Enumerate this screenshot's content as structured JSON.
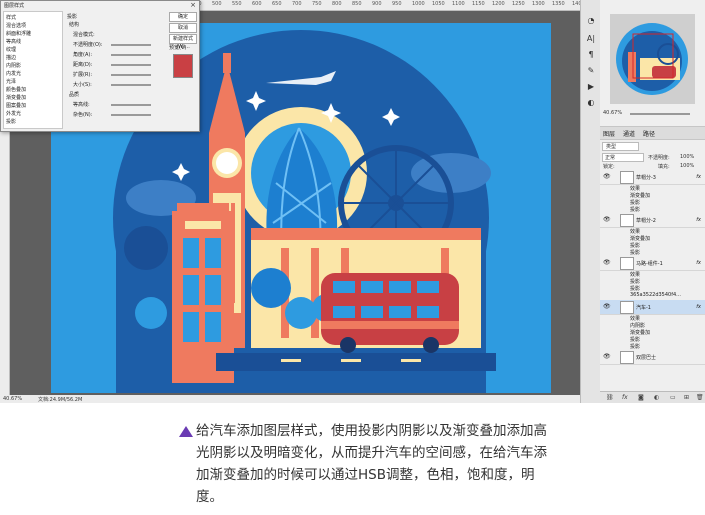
{
  "rulers": {
    "top_ticks": [
      "0",
      "50",
      "100",
      "150",
      "200",
      "250",
      "300",
      "350",
      "400",
      "450",
      "500",
      "550",
      "600",
      "650",
      "700",
      "750",
      "800",
      "850",
      "900",
      "950",
      "1000",
      "1050",
      "1100",
      "1150",
      "1200",
      "1250",
      "1300",
      "1350",
      "1400"
    ]
  },
  "status_bar": {
    "zoom": "40.67%",
    "doc": "文档:24.9M/56.2M"
  },
  "dialog": {
    "title": "图层样式",
    "close": "×",
    "left_items": [
      "样式",
      "混合选项",
      "斜面和浮雕",
      "等高线",
      "纹理",
      "描边",
      "内阴影",
      "内发光",
      "光泽",
      "颜色叠加",
      "渐变叠加",
      "图案叠加",
      "外发光",
      "投影"
    ],
    "mid_heading": "投影",
    "mid_labels": [
      "结构",
      "混合模式:",
      "不透明度(O):",
      "角度(A):",
      "距离(D):",
      "扩展(R):",
      "大小(S):",
      "品质",
      "等高线:",
      "杂色(N):"
    ],
    "buttons": [
      "确定",
      "取消",
      "新建样式(W)...",
      "预览(V)"
    ]
  },
  "navigator_zoom": "40.67%",
  "panel_tabs": [
    "图层",
    "通道",
    "路径"
  ],
  "layer_options": {
    "kind": "类型",
    "blend": "正常",
    "opacity_label": "不透明度:",
    "opacity": "100%",
    "lock": "锁定:",
    "fill_label": "填充:",
    "fill": "100%"
  },
  "layers": [
    {
      "name": "草帽分-3",
      "fx": "fx",
      "subs": [
        "效果",
        "渐变叠加",
        "投影",
        "投影"
      ]
    },
    {
      "name": "草帽分-2",
      "fx": "fx",
      "subs": [
        "效果",
        "渐变叠加",
        "投影",
        "投影"
      ]
    },
    {
      "name": "马路-组件-1",
      "fx": "fx",
      "subs": [
        "效果",
        "投影",
        "投影"
      ]
    },
    {
      "name": "汽车-1",
      "fx": "fx",
      "subs": [
        "效果",
        "内阴影",
        "渐变叠加",
        "投影",
        "投影"
      ],
      "selected": true
    },
    {
      "name": "双层巴士",
      "fx": "",
      "subs": []
    }
  ],
  "layer_extra": "365a3522d3540f4...",
  "caption": "给汽车添加图层样式，使用投影内阴影以及渐变叠加添加高光阴影以及明暗变化，从而提升汽车的空间感，在给汽车添加渐变叠加的时候可以通过HSB调整，色相，饱和度，明度。",
  "colors": {
    "canvas_bg": "#2e9be0",
    "dark_blue": "#1d5ea8",
    "salmon": "#ef7a5f",
    "cream": "#fbe6a8",
    "bus_red": "#c84044",
    "accent_purple": "#6a3bb3"
  }
}
